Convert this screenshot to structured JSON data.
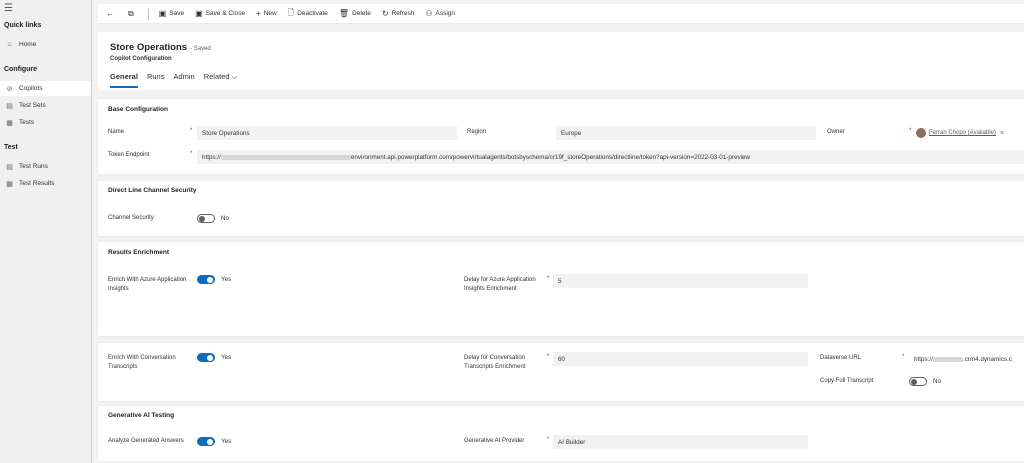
{
  "sidebar": {
    "menu_icon": "hamburger-icon",
    "quick_links_heading": "Quick links",
    "home": {
      "label": "Home",
      "icon": "home-icon"
    },
    "configure_heading": "Configure",
    "configure_items": [
      {
        "label": "Copilots",
        "icon": "copilot-icon",
        "active": true
      },
      {
        "label": "Test Sets",
        "icon": "test-sets-icon"
      },
      {
        "label": "Tests",
        "icon": "tests-icon"
      }
    ],
    "test_heading": "Test",
    "test_items": [
      {
        "label": "Test Runs",
        "icon": "test-runs-icon"
      },
      {
        "label": "Test Results",
        "icon": "test-results-icon"
      }
    ]
  },
  "toolbar": {
    "save": "Save",
    "save_close": "Save & Close",
    "new": "New",
    "deactivate": "Deactivate",
    "delete": "Delete",
    "refresh": "Refresh",
    "assign": "Assign"
  },
  "header": {
    "title": "Store Operations",
    "saved_status": "- Saved",
    "entity": "Copilot Configuration",
    "tabs": [
      "General",
      "Runs",
      "Admin",
      "Related"
    ]
  },
  "base_config": {
    "title": "Base Configuration",
    "name_label": "Name",
    "name_value": "Store Operations",
    "region_label": "Region",
    "region_value": "Europe",
    "owner_label": "Owner",
    "owner_value": "Ferran Chopo (Available)",
    "token_label": "Token Endpoint",
    "token_prefix": "https://",
    "token_suffix": "environment.api.powerplatform.com/powervirtualagents/botsbyschema/cr19f_storeOperations/directline/token?api-version=2022-03-01-preview"
  },
  "direct_line": {
    "title": "Direct Line Channel Security",
    "channel_security_label": "Channel Security",
    "channel_security_value": "No"
  },
  "results_enrichment": {
    "title": "Results Enrichment",
    "enrich_ai_label": "Enrich With Azure Application Insights",
    "enrich_ai_value": "Yes",
    "delay_ai_label": "Delay for Azure Application Insights Enrichment",
    "delay_ai_value": "5"
  },
  "conversation": {
    "enrich_label": "Enrich With Conversation Transcripts",
    "enrich_value": "Yes",
    "delay_label": "Delay for Conversation Transcripts Enrichment",
    "delay_value": "60",
    "dataverse_label": "Dataverse URL",
    "dataverse_prefix": "https://",
    "dataverse_suffix": ".crm4.dynamics.c",
    "copy_label": "Copy Full Transcript",
    "copy_value": "No"
  },
  "generative": {
    "title": "Generative AI Testing",
    "analyze_label": "Analyze Generated Answers",
    "analyze_value": "Yes",
    "provider_label": "Generative AI Provider",
    "provider_value": "AI Builder"
  },
  "colors": {
    "accent": "#0f6cbd",
    "required": "#a4262c"
  }
}
